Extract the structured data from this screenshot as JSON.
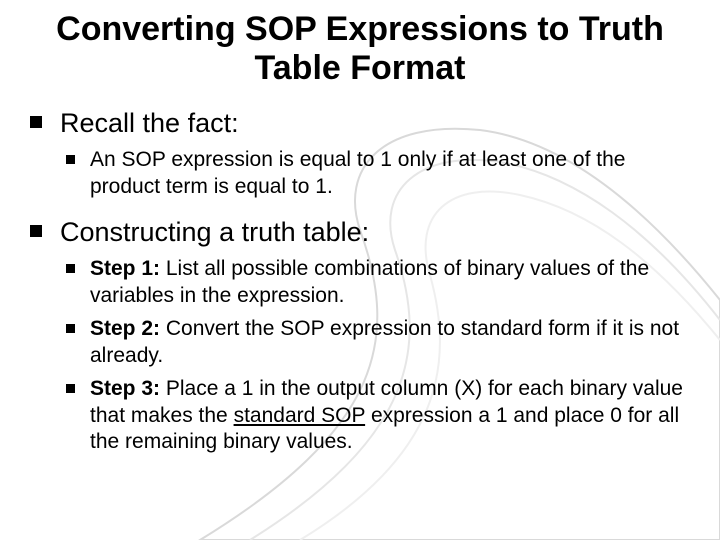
{
  "title": "Converting SOP Expressions to Truth Table Format",
  "items": [
    {
      "label": "Recall the fact:",
      "sub": [
        {
          "plain": "An SOP expression is equal to 1 only if at least one of the product term is equal to 1."
        }
      ]
    },
    {
      "label": "Constructing a truth table:",
      "sub": [
        {
          "bold": "Step 1:",
          "rest": " List all possible combinations of binary values of the variables in the expression."
        },
        {
          "bold": "Step 2:",
          "rest": " Convert the SOP expression to standard form if it is not already."
        },
        {
          "bold": "Step 3:",
          "rest_a": " Place a 1 in the output column (X) for each binary value that makes the ",
          "under": "standard SOP",
          "rest_b": " expression a 1 and place 0 for all the remaining binary values."
        }
      ]
    }
  ]
}
